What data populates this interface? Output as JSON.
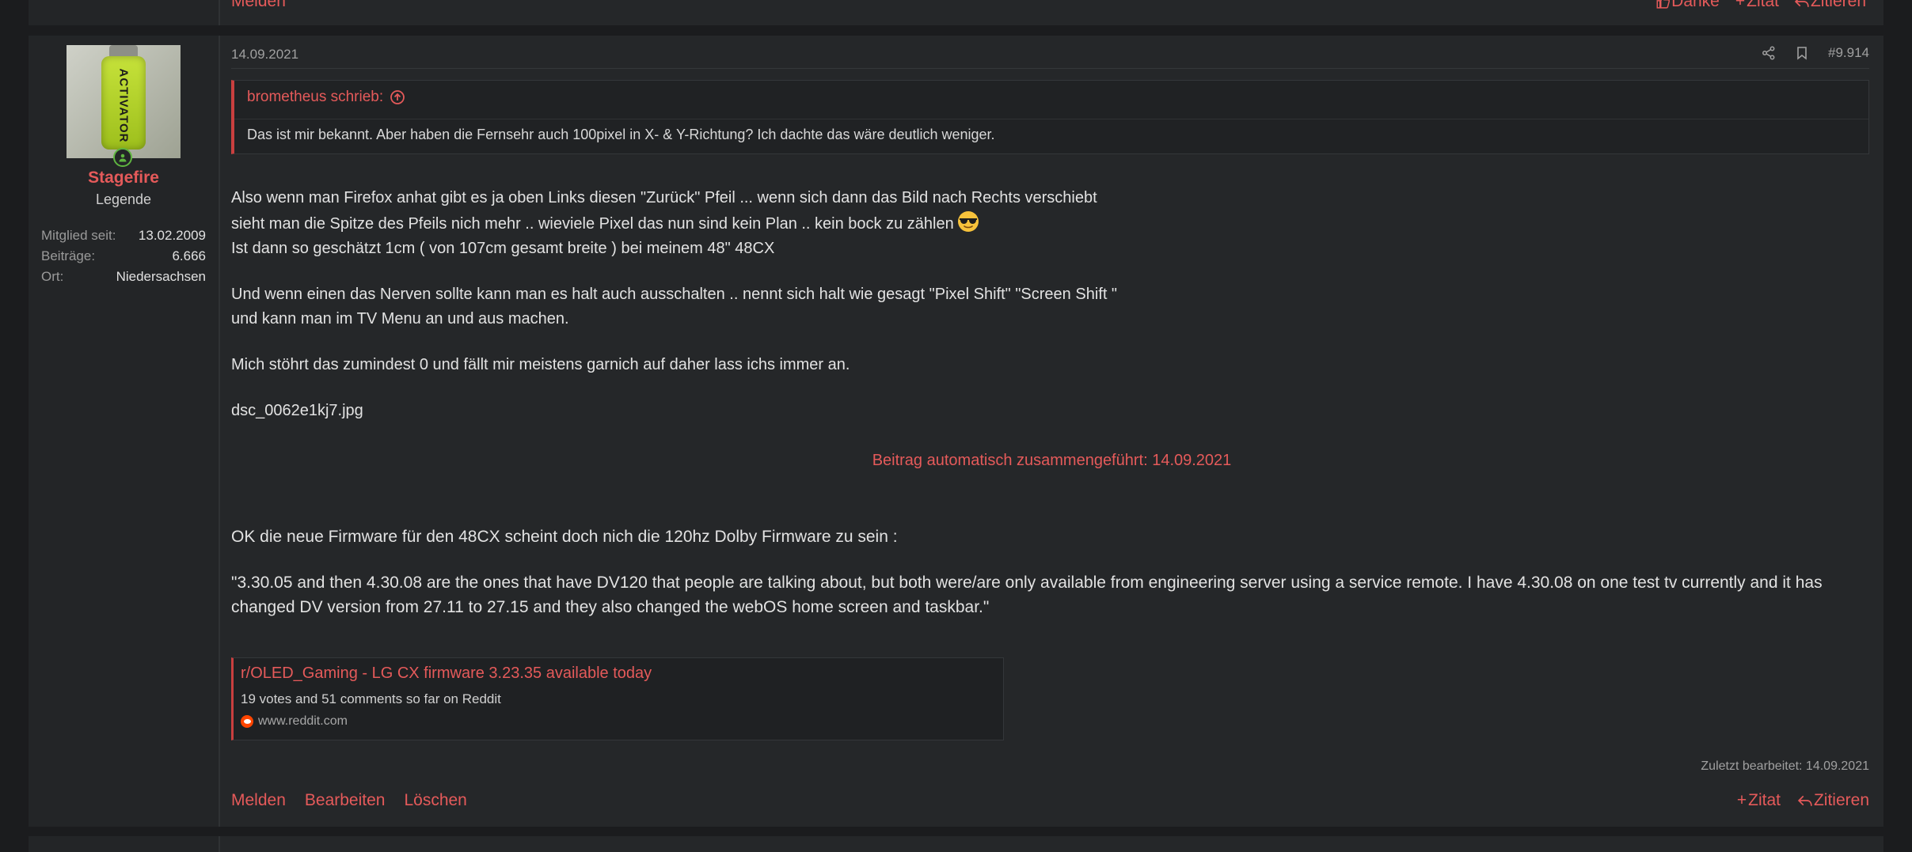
{
  "prev_post": {
    "action_report": "Melden",
    "action_thanks": "Danke",
    "action_plus_quote": "Zitat",
    "action_quote": "Zitieren"
  },
  "user": {
    "avatar_text": "ACTIVATOR",
    "name": "Stagefire",
    "title": "Legende",
    "stats": [
      {
        "label": "Mitglied seit:",
        "value": "13.02.2009"
      },
      {
        "label": "Beiträge:",
        "value": "6.666"
      },
      {
        "label": "Ort:",
        "value": "Niedersachsen"
      }
    ]
  },
  "post": {
    "date": "14.09.2021",
    "number": "#9.914",
    "quote": {
      "author": "brometheus schrieb:",
      "text": "Das ist mir bekannt. Aber haben die Fernsehr auch 100pixel in X- & Y-Richtung? Ich dachte das wäre deutlich weniger."
    },
    "lines": [
      "Also wenn man Firefox anhat gibt es ja oben Links diesen \"Zurück\" Pfeil ... wenn sich dann das Bild nach Rechts verschiebt",
      "sieht man die Spitze des Pfeils nich mehr .. wieviele Pixel das nun sind kein Plan .. kein bock zu zählen",
      "Ist dann so geschätzt 1cm ( von 107cm gesamt breite ) bei meinem 48\" 48CX",
      "Und wenn einen das Nerven sollte kann man es halt auch ausschalten .. nennt sich halt wie gesagt \"Pixel Shift\" \"Screen Shift \"",
      "und kann man im TV Menu an und aus machen.",
      "Mich stöhrt das zumindest 0 und fällt mir meistens garnich auf daher lass ichs immer an.",
      "dsc_0062e1kj7.jpg"
    ],
    "merged_notice": "Beitrag automatisch zusammengeführt: 14.09.2021",
    "lines2": [
      "OK die neue Firmware für den 48CX scheint doch nich die 120hz Dolby Firmware zu sein :",
      "\"3.30.05 and then 4.30.08 are the ones that have DV120 that people are talking about, but both were/are only available from engineering server using a service remote. I have 4.30.08 on one test tv currently and it has changed DV version from 27.11 to 27.15 and they also changed the webOS home screen and taskbar.\""
    ],
    "embed": {
      "title": "r/OLED_Gaming - LG CX firmware 3.23.35 available today",
      "description": "19 votes and 51 comments so far on Reddit",
      "source": "www.reddit.com"
    },
    "edited": "Zuletzt bearbeitet: 14.09.2021",
    "actions_left": [
      "Melden",
      "Bearbeiten",
      "Löschen"
    ],
    "action_plus_quote": "Zitat",
    "action_quote": "Zitieren"
  },
  "colors": {
    "accent": "#e55a5a",
    "background": "#1b1c1e",
    "post_bg": "#252729",
    "online": "#5fb540"
  }
}
